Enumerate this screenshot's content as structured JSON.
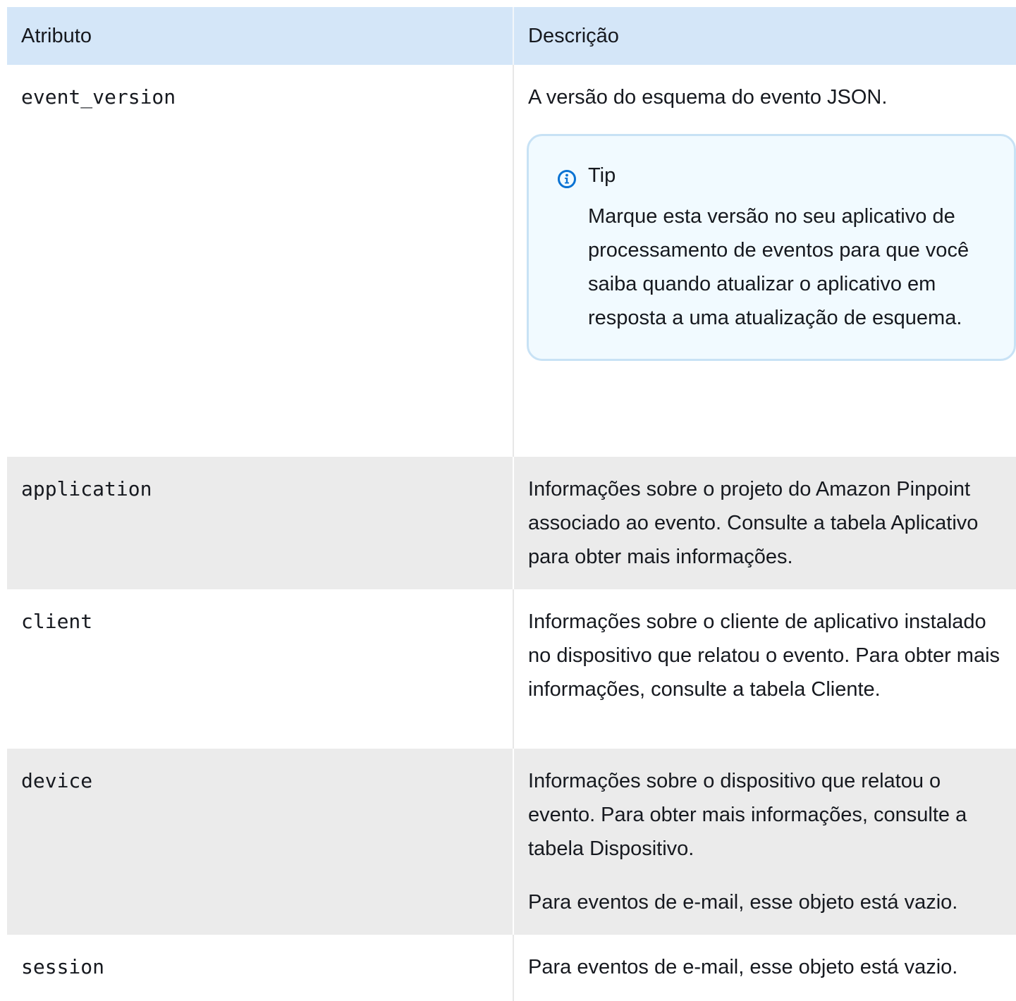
{
  "table": {
    "headers": [
      "Atributo",
      "Descrição"
    ],
    "rows": [
      {
        "attribute": "event_version",
        "description": [
          "A versão do esquema do evento JSON."
        ],
        "tip": {
          "title": "Tip",
          "icon": "info-icon",
          "text": "Marque esta versão no seu aplicativo de processamento de eventos para que você saiba quando atualizar o aplicativo em resposta a uma atualização de esquema."
        }
      },
      {
        "attribute": "application",
        "description": [
          "Informações sobre o projeto do Amazon Pinpoint associado ao evento. Consulte a tabela Aplicativo para obter mais informações."
        ]
      },
      {
        "attribute": "client",
        "description": [
          "Informações sobre o cliente de aplicativo instalado no dispositivo que relatou o evento. Para obter mais informações, consulte a tabela Cliente."
        ]
      },
      {
        "attribute": "device",
        "description": [
          "Informações sobre o dispositivo que relatou o evento. Para obter mais informações, consulte a tabela Dispositivo.",
          "Para eventos de e-mail, esse objeto está vazio."
        ]
      },
      {
        "attribute": "session",
        "description": [
          "Para eventos de e-mail, esse objeto está vazio."
        ]
      }
    ]
  },
  "colors": {
    "header_bg": "#d4e6f8",
    "row_alt_bg": "#ebebeb",
    "tip_bg": "#f1faff",
    "tip_border": "#c8e2f5",
    "icon": "#0972d3"
  }
}
